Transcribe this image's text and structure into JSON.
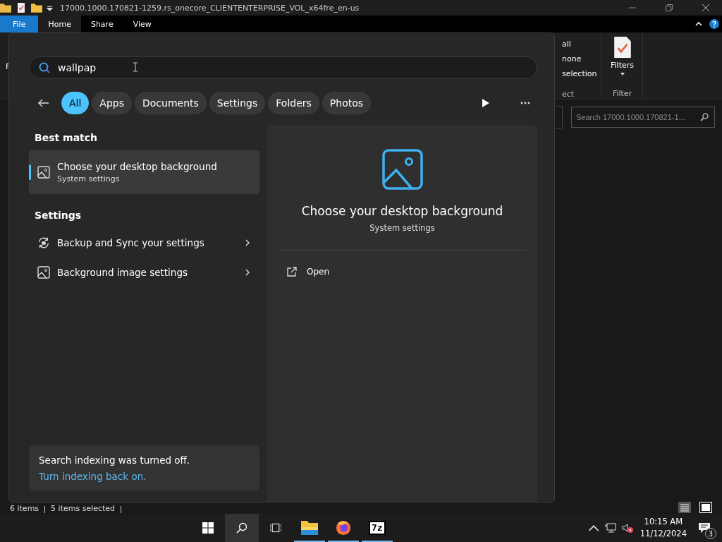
{
  "explorer": {
    "title": "17000.1000.170821-1259.rs_onecore_CLIENTENTERPRISE_VOL_x64fre_en-us",
    "ribbon_tabs": [
      {
        "label": "File",
        "selected": false,
        "kind": "file"
      },
      {
        "label": "Home",
        "selected": true,
        "kind": "tab"
      },
      {
        "label": "Share",
        "selected": false,
        "kind": "tab"
      },
      {
        "label": "View",
        "selected": false,
        "kind": "tab"
      }
    ],
    "ribbon_fragment": "F",
    "select_commands": [
      "all",
      "none",
      "selection"
    ],
    "select_group": "ect",
    "filters_button": "Filters",
    "filter_group": "Filter",
    "search": {
      "placeholder": "Search 17000.1000.170821-1..."
    },
    "status_bar": [
      "6 items",
      "5 items selected"
    ]
  },
  "search_panel": {
    "query": "wallpap",
    "filters": [
      {
        "label": "All",
        "selected": true
      },
      {
        "label": "Apps",
        "selected": false
      },
      {
        "label": "Documents",
        "selected": false
      },
      {
        "label": "Settings",
        "selected": false
      },
      {
        "label": "Folders",
        "selected": false
      },
      {
        "label": "Photos",
        "selected": false
      }
    ],
    "best_match_heading": "Best match",
    "best_match": {
      "title": "Choose your desktop background",
      "subtitle": "System settings",
      "selected": true
    },
    "settings_heading": "Settings",
    "settings_results": [
      {
        "title": "Backup and Sync your settings",
        "kind": "sync"
      },
      {
        "title": "Background image settings",
        "kind": "image"
      }
    ],
    "preview": {
      "title": "Choose your desktop background",
      "subtitle": "System settings",
      "actions": [
        "Open"
      ]
    },
    "notice": {
      "text": "Search indexing was turned off.",
      "link": "Turn indexing back on."
    }
  },
  "taskbar": {
    "apps": [
      {
        "kind": "start"
      },
      {
        "kind": "search",
        "selected": true
      },
      {
        "kind": "taskview",
        "selected": false
      },
      {
        "kind": "folder",
        "selected": false,
        "running": true
      },
      {
        "kind": "firefox",
        "selected": false,
        "running": true
      },
      {
        "kind": "zip",
        "label": "7z",
        "selected": false,
        "running": true
      }
    ],
    "time": "10:15 AM",
    "date": "11/12/2024",
    "notifications": "3"
  }
}
